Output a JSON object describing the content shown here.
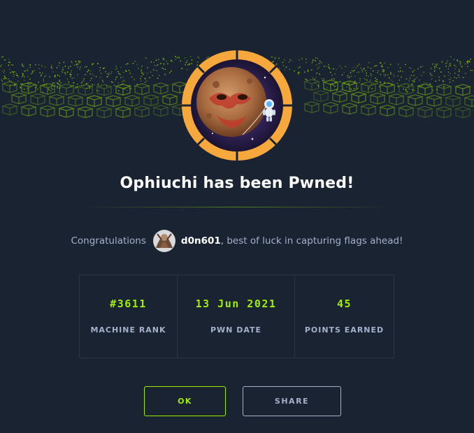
{
  "modal": {
    "title": "Ophiuchi has been Pwned!",
    "congrats_prefix": "Congratulations",
    "username": "d0n601",
    "congrats_suffix": ", best of luck in capturing flags ahead!"
  },
  "stats": [
    {
      "value": "#3611",
      "label": "MACHINE RANK"
    },
    {
      "value": "13 Jun 2021",
      "label": "PWN DATE"
    },
    {
      "value": "45",
      "label": "POINTS EARNED"
    }
  ],
  "buttons": {
    "ok_label": "OK",
    "share_label": "SHARE"
  },
  "colors": {
    "background": "#1a2332",
    "accent_green": "#9fef00",
    "badge_ring": "#f7a83c",
    "text_muted": "#a4b1cd"
  }
}
